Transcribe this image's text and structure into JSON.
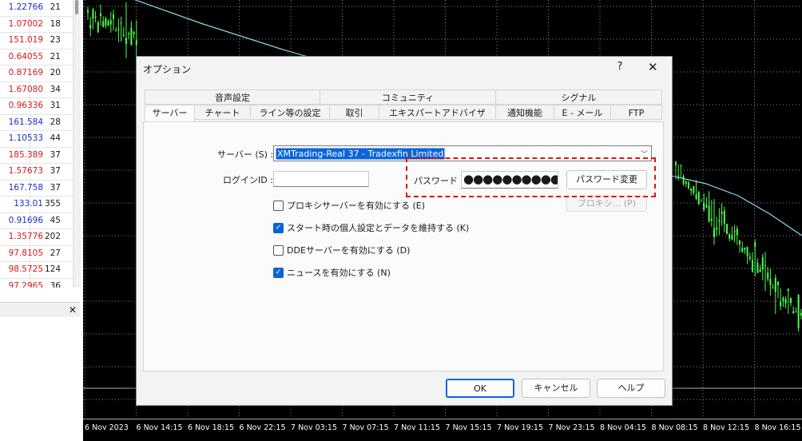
{
  "market_watch": {
    "rows": [
      {
        "price": "1.22766",
        "spread": "21",
        "color": "blue"
      },
      {
        "price": "1.07002",
        "spread": "18",
        "color": "red"
      },
      {
        "price": "151.019",
        "spread": "23",
        "color": "red"
      },
      {
        "price": "0.64055",
        "spread": "21",
        "color": "red"
      },
      {
        "price": "0.87169",
        "spread": "20",
        "color": "red"
      },
      {
        "price": "1.67080",
        "spread": "34",
        "color": "red"
      },
      {
        "price": "0.96336",
        "spread": "31",
        "color": "red"
      },
      {
        "price": "161.584",
        "spread": "28",
        "color": "blue"
      },
      {
        "price": "1.10533",
        "spread": "44",
        "color": "blue"
      },
      {
        "price": "185.389",
        "spread": "37",
        "color": "red"
      },
      {
        "price": "1.57673",
        "spread": "37",
        "color": "red"
      },
      {
        "price": "167.758",
        "spread": "37",
        "color": "blue"
      },
      {
        "price": "133.01",
        "spread": "355",
        "color": "blue"
      },
      {
        "price": "0.91696",
        "spread": "45",
        "color": "blue"
      },
      {
        "price": "1.35776",
        "spread": "202",
        "color": "red"
      },
      {
        "price": "97.8105",
        "spread": "27",
        "color": "red"
      },
      {
        "price": "98.5725",
        "spread": "124",
        "color": "red"
      },
      {
        "price": "97.2965",
        "spread": "36",
        "color": "red"
      }
    ],
    "close_icon": "close-icon"
  },
  "chart": {
    "x_labels": [
      "6 Nov 2023",
      "6 Nov 14:15",
      "6 Nov 18:15",
      "6 Nov 22:15",
      "7 Nov 03:15",
      "7 Nov 07:15",
      "7 Nov 11:15",
      "7 Nov 15:15",
      "7 Nov 19:15",
      "7 Nov 23:15",
      "8 Nov 04:15",
      "8 Nov 08:15",
      "8 Nov 12:15",
      "8 Nov 16:15"
    ],
    "background": "#000000",
    "candle_color": "#4cff4c",
    "ma_color": "#8fd8e8"
  },
  "dialog": {
    "title": "オプション",
    "help_label": "?",
    "close_label": "✕",
    "tabs_row1": [
      "音声設定",
      "コミュニティ",
      "シグナル"
    ],
    "tabs_row2": [
      "サーバー",
      "チャート",
      "ライン等の設定",
      "取引",
      "エキスパートアドバイザ",
      "通知機能",
      "E - メール",
      "FTP"
    ],
    "server": {
      "label": "サーバー (S) :",
      "value": "XMTrading-Real 37 - Tradexfin Limited"
    },
    "login": {
      "label": "ログインID :",
      "value": ""
    },
    "password": {
      "label": "パスワード :",
      "value": "●●●●●●●●●●●●●"
    },
    "buttons": {
      "change_password": "パスワード変更",
      "proxy": "プロキシ... (P)",
      "ok": "OK",
      "cancel": "キャンセル",
      "help": "ヘルプ"
    },
    "checkboxes": [
      {
        "label": "プロキシサーバーを有効にする (E)",
        "checked": false
      },
      {
        "label": "スタート時の個人設定とデータを維持する (K)",
        "checked": true
      },
      {
        "label": "DDEサーバーを有効にする (D)",
        "checked": false
      },
      {
        "label": "ニュースを有効にする (N)",
        "checked": true
      }
    ],
    "highlight_color": "#e01010",
    "accent_color": "#0a64d8"
  }
}
